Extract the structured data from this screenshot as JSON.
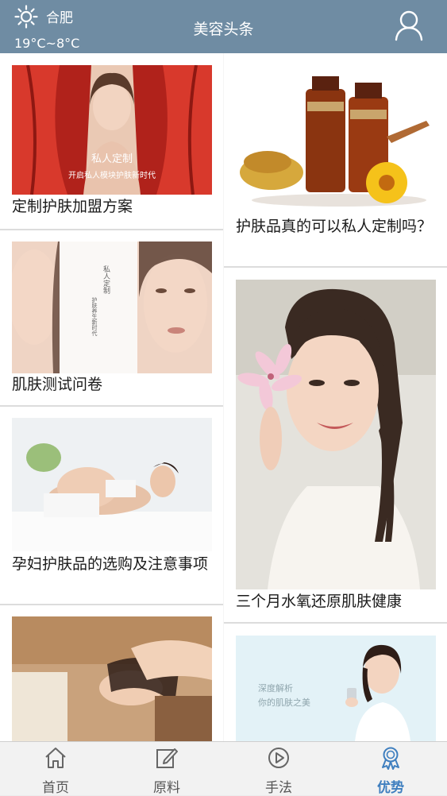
{
  "header": {
    "city": "合肥",
    "temperature": "19°C~8°C",
    "title": "美容头条",
    "weather_icon": "sun-icon",
    "user_icon": "user-icon"
  },
  "feed": {
    "left": [
      {
        "caption": "定制护肤加盟方案",
        "image_text_1": "私人定制",
        "image_text_2": "开启私人模块护肤新时代"
      },
      {
        "caption": "肌肤测试问卷",
        "image_text_1": "私人定制",
        "image_text_2": "护肤养生新时代"
      },
      {
        "caption": "孕妇护肤品的选购及注意事项"
      },
      {
        "caption": ""
      }
    ],
    "right": [
      {
        "caption": "护肤品真的可以私人定制吗？"
      },
      {
        "caption": "三个月水氧还原肌肤健康"
      },
      {
        "caption": "",
        "image_text_1": "深度解析",
        "image_text_2": "你的肌肤之美"
      }
    ]
  },
  "tabbar": {
    "tabs": [
      {
        "label": "首页",
        "icon": "home-icon"
      },
      {
        "label": "原料",
        "icon": "edit-icon"
      },
      {
        "label": "手法",
        "icon": "play-icon"
      },
      {
        "label": "优势",
        "icon": "award-icon"
      }
    ],
    "active_index": 3,
    "active_color": "#3f7fbf",
    "header_color": "#6f8ca3"
  }
}
